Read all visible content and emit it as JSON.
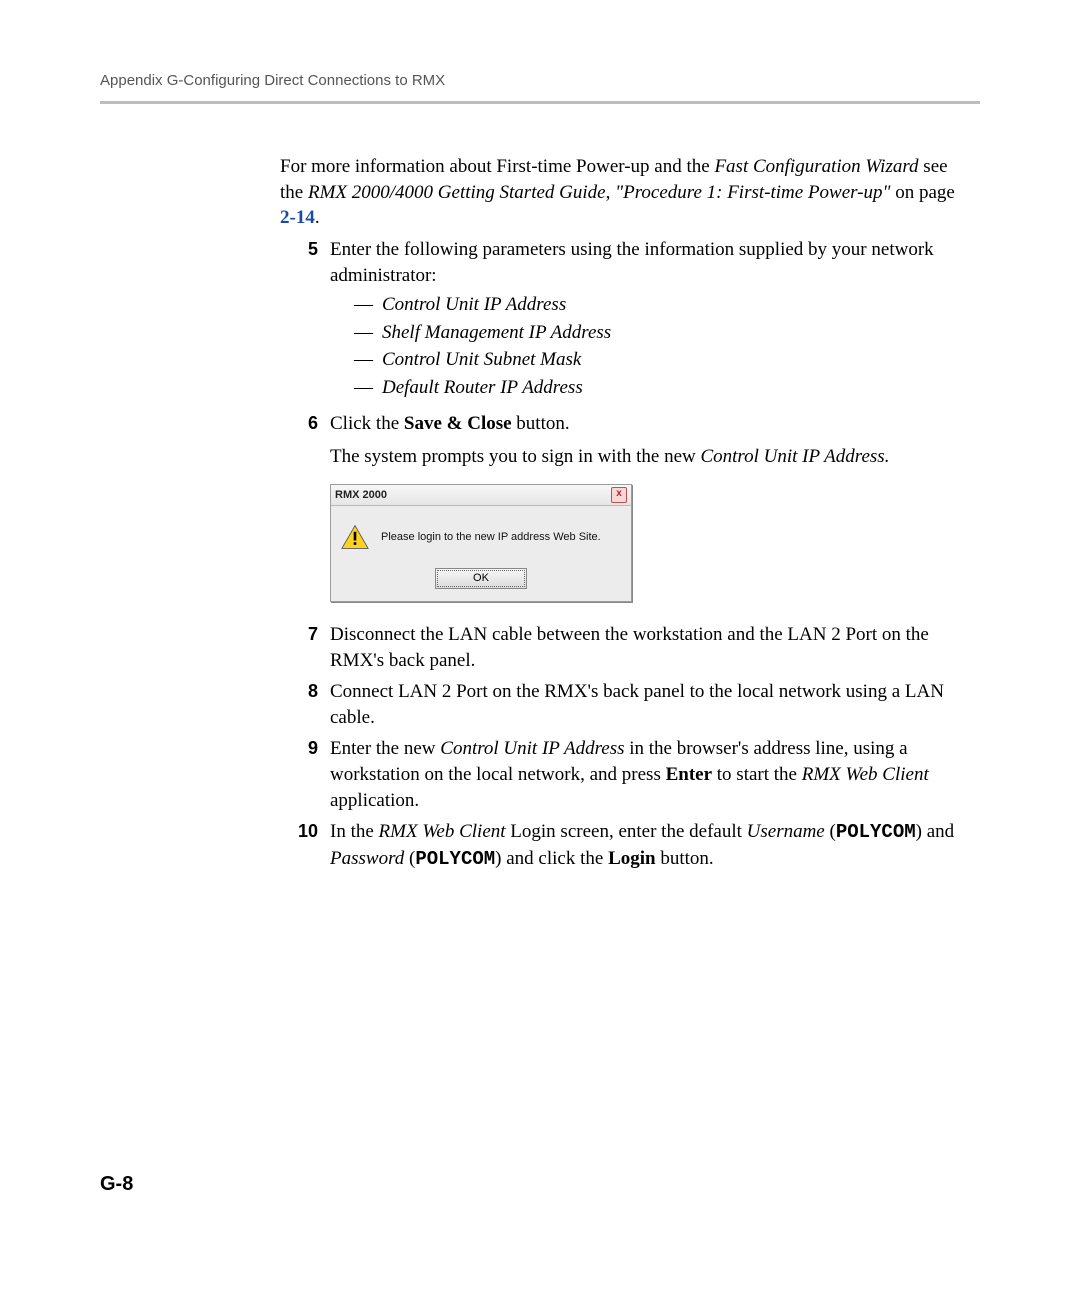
{
  "header": "Appendix G-Configuring Direct Connections to RMX",
  "intro": {
    "t1a": "For more information about First-time Power-up and the ",
    "t1b": "Fast Configuration Wizard",
    "t1c": " see the ",
    "t1d": "RMX 2000/4000 Getting Started Guide",
    "t1e": ", ",
    "t1f": "\"Procedure 1: First-time Power-up\"",
    "t1g": " on page ",
    "t1h": "2-14",
    "t1i": "."
  },
  "step5": {
    "num": "5",
    "text": "Enter the following parameters using the information supplied by your network administrator:",
    "items": [
      "Control Unit IP Address",
      "Shelf Management IP Address",
      "Control Unit Subnet Mask",
      "Default Router IP Address"
    ]
  },
  "step6": {
    "num": "6",
    "a": "Click the ",
    "b": "Save & Close",
    "c": " button.",
    "p2a": "The system prompts you to sign in with the new ",
    "p2b": "Control Unit IP Address.",
    "dialog": {
      "title": "RMX 2000",
      "msg": "Please login to the new IP address Web Site.",
      "ok": "OK"
    }
  },
  "step7": {
    "num": "7",
    "text": "Disconnect the LAN cable between the workstation and the LAN 2 Port on the RMX's back panel."
  },
  "step8": {
    "num": "8",
    "text": "Connect LAN 2 Port on the RMX's back panel to the local network using a LAN cable."
  },
  "step9": {
    "num": "9",
    "a": "Enter the new ",
    "b": "Control Unit IP Address",
    "c": " in the browser's address line, using a workstation on the local network, and press ",
    "d": "Enter",
    "e": " to start the ",
    "f": "RMX Web Client",
    "g": " application."
  },
  "step10": {
    "num": "10",
    "a": "In the ",
    "b": "RMX Web Client",
    "c": " Login screen, enter the default ",
    "d": "Username",
    "e": " (",
    "f": "POLYCOM",
    "g": ") and ",
    "h": "Password",
    "i": " (",
    "j": "POLYCOM",
    "k": ") and click the ",
    "l": "Login",
    "m": " button."
  },
  "footer": "G-8"
}
